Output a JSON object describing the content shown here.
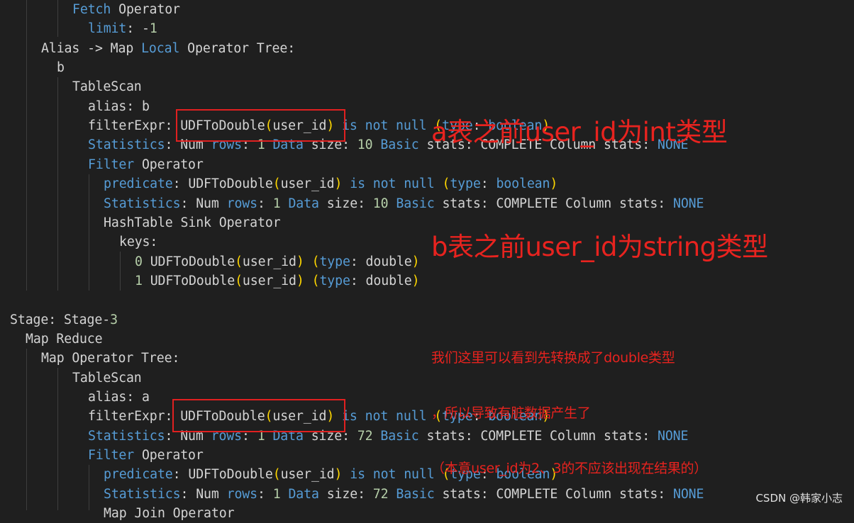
{
  "colors": {
    "background": "#1f1f1f",
    "plain": "#d4d4d4",
    "keyword": "#569cd6",
    "number": "#b5cea8",
    "paren": "#ffd700",
    "annotation": "#e8231f",
    "highlight_box": "#e02020"
  },
  "code_lines": [
    {
      "indent": 9,
      "tokens": [
        [
          "kw",
          "Fetch"
        ],
        [
          "plain",
          " Operator"
        ]
      ]
    },
    {
      "indent": 11,
      "tokens": [
        [
          "kw",
          "limit"
        ],
        [
          "plain",
          ": -"
        ],
        [
          "num",
          "1"
        ]
      ]
    },
    {
      "indent": 5,
      "tokens": [
        [
          "plain",
          "Alias -> Map "
        ],
        [
          "kw",
          "Local"
        ],
        [
          "plain",
          " Operator Tree:"
        ]
      ]
    },
    {
      "indent": 7,
      "tokens": [
        [
          "plain",
          "b"
        ]
      ]
    },
    {
      "indent": 9,
      "tokens": [
        [
          "plain",
          "TableScan"
        ]
      ]
    },
    {
      "indent": 11,
      "tokens": [
        [
          "plain",
          "alias: b"
        ]
      ]
    },
    {
      "indent": 11,
      "tokens": [
        [
          "plain",
          "filterExpr: UDFToDouble"
        ],
        [
          "paren",
          "("
        ],
        [
          "plain",
          "user_id"
        ],
        [
          "paren",
          ")"
        ],
        [
          "plain",
          " "
        ],
        [
          "kw",
          "is not null"
        ],
        [
          "plain",
          " "
        ],
        [
          "paren",
          "("
        ],
        [
          "kw",
          "type"
        ],
        [
          "plain",
          ": "
        ],
        [
          "kw",
          "boolean"
        ],
        [
          "paren",
          ")"
        ]
      ]
    },
    {
      "indent": 11,
      "tokens": [
        [
          "kw",
          "Statistics"
        ],
        [
          "plain",
          ": Num "
        ],
        [
          "kw",
          "rows"
        ],
        [
          "plain",
          ": "
        ],
        [
          "num",
          "1"
        ],
        [
          "plain",
          " "
        ],
        [
          "kw",
          "Data"
        ],
        [
          "plain",
          " size: "
        ],
        [
          "num",
          "10"
        ],
        [
          "plain",
          " "
        ],
        [
          "kw",
          "Basic"
        ],
        [
          "plain",
          " stats: COMPLETE Column stats: "
        ],
        [
          "kw",
          "NONE"
        ]
      ]
    },
    {
      "indent": 11,
      "tokens": [
        [
          "kw",
          "Filter"
        ],
        [
          "plain",
          " Operator"
        ]
      ]
    },
    {
      "indent": 13,
      "tokens": [
        [
          "kw",
          "predicate"
        ],
        [
          "plain",
          ": UDFToDouble"
        ],
        [
          "paren",
          "("
        ],
        [
          "plain",
          "user_id"
        ],
        [
          "paren",
          ")"
        ],
        [
          "plain",
          " "
        ],
        [
          "kw",
          "is not null"
        ],
        [
          "plain",
          " "
        ],
        [
          "paren",
          "("
        ],
        [
          "kw",
          "type"
        ],
        [
          "plain",
          ": "
        ],
        [
          "kw",
          "boolean"
        ],
        [
          "paren",
          ")"
        ]
      ]
    },
    {
      "indent": 13,
      "tokens": [
        [
          "kw",
          "Statistics"
        ],
        [
          "plain",
          ": Num "
        ],
        [
          "kw",
          "rows"
        ],
        [
          "plain",
          ": "
        ],
        [
          "num",
          "1"
        ],
        [
          "plain",
          " "
        ],
        [
          "kw",
          "Data"
        ],
        [
          "plain",
          " size: "
        ],
        [
          "num",
          "10"
        ],
        [
          "plain",
          " "
        ],
        [
          "kw",
          "Basic"
        ],
        [
          "plain",
          " stats: COMPLETE Column stats: "
        ],
        [
          "kw",
          "NONE"
        ]
      ]
    },
    {
      "indent": 13,
      "tokens": [
        [
          "plain",
          "HashTable Sink Operator"
        ]
      ]
    },
    {
      "indent": 15,
      "tokens": [
        [
          "plain",
          "keys:"
        ]
      ]
    },
    {
      "indent": 17,
      "tokens": [
        [
          "num",
          "0"
        ],
        [
          "plain",
          " UDFToDouble"
        ],
        [
          "paren",
          "("
        ],
        [
          "plain",
          "user_id"
        ],
        [
          "paren",
          ")"
        ],
        [
          "plain",
          " "
        ],
        [
          "paren",
          "("
        ],
        [
          "kw",
          "type"
        ],
        [
          "plain",
          ": double"
        ],
        [
          "paren",
          ")"
        ]
      ]
    },
    {
      "indent": 17,
      "tokens": [
        [
          "num",
          "1"
        ],
        [
          "plain",
          " UDFToDouble"
        ],
        [
          "paren",
          "("
        ],
        [
          "plain",
          "user_id"
        ],
        [
          "paren",
          ")"
        ],
        [
          "plain",
          " "
        ],
        [
          "paren",
          "("
        ],
        [
          "kw",
          "type"
        ],
        [
          "plain",
          ": double"
        ],
        [
          "paren",
          ")"
        ]
      ]
    },
    {
      "indent": 0,
      "tokens": []
    },
    {
      "indent": 1,
      "tokens": [
        [
          "plain",
          "Stage: Stage-"
        ],
        [
          "num",
          "3"
        ]
      ]
    },
    {
      "indent": 3,
      "tokens": [
        [
          "plain",
          "Map Reduce"
        ]
      ]
    },
    {
      "indent": 5,
      "tokens": [
        [
          "plain",
          "Map Operator Tree:"
        ]
      ]
    },
    {
      "indent": 9,
      "tokens": [
        [
          "plain",
          "TableScan"
        ]
      ]
    },
    {
      "indent": 11,
      "tokens": [
        [
          "plain",
          "alias: a"
        ]
      ]
    },
    {
      "indent": 11,
      "tokens": [
        [
          "plain",
          "filterExpr: UDFToDouble"
        ],
        [
          "paren",
          "("
        ],
        [
          "plain",
          "user_id"
        ],
        [
          "paren",
          ")"
        ],
        [
          "plain",
          " "
        ],
        [
          "kw",
          "is not null"
        ],
        [
          "plain",
          " "
        ],
        [
          "paren",
          "("
        ],
        [
          "kw",
          "type"
        ],
        [
          "plain",
          ": "
        ],
        [
          "kw",
          "boolean"
        ],
        [
          "paren",
          ")"
        ]
      ]
    },
    {
      "indent": 11,
      "tokens": [
        [
          "kw",
          "Statistics"
        ],
        [
          "plain",
          ": Num "
        ],
        [
          "kw",
          "rows"
        ],
        [
          "plain",
          ": "
        ],
        [
          "num",
          "1"
        ],
        [
          "plain",
          " "
        ],
        [
          "kw",
          "Data"
        ],
        [
          "plain",
          " size: "
        ],
        [
          "num",
          "72"
        ],
        [
          "plain",
          " "
        ],
        [
          "kw",
          "Basic"
        ],
        [
          "plain",
          " stats: COMPLETE Column stats: "
        ],
        [
          "kw",
          "NONE"
        ]
      ]
    },
    {
      "indent": 11,
      "tokens": [
        [
          "kw",
          "Filter"
        ],
        [
          "plain",
          " Operator"
        ]
      ]
    },
    {
      "indent": 13,
      "tokens": [
        [
          "kw",
          "predicate"
        ],
        [
          "plain",
          ": UDFToDouble"
        ],
        [
          "paren",
          "("
        ],
        [
          "plain",
          "user_id"
        ],
        [
          "paren",
          ")"
        ],
        [
          "plain",
          " "
        ],
        [
          "kw",
          "is not null"
        ],
        [
          "plain",
          " "
        ],
        [
          "paren",
          "("
        ],
        [
          "kw",
          "type"
        ],
        [
          "plain",
          ": "
        ],
        [
          "kw",
          "boolean"
        ],
        [
          "paren",
          ")"
        ]
      ]
    },
    {
      "indent": 13,
      "tokens": [
        [
          "kw",
          "Statistics"
        ],
        [
          "plain",
          ": Num "
        ],
        [
          "kw",
          "rows"
        ],
        [
          "plain",
          ": "
        ],
        [
          "num",
          "1"
        ],
        [
          "plain",
          " "
        ],
        [
          "kw",
          "Data"
        ],
        [
          "plain",
          " size: "
        ],
        [
          "num",
          "72"
        ],
        [
          "plain",
          " "
        ],
        [
          "kw",
          "Basic"
        ],
        [
          "plain",
          " stats: COMPLETE Column stats: "
        ],
        [
          "kw",
          "NONE"
        ]
      ]
    },
    {
      "indent": 13,
      "tokens": [
        [
          "plain",
          "Map Join Operator"
        ]
      ]
    }
  ],
  "annotations": {
    "top_note": [
      "a表之前user_id为int类型",
      "b表之前user_id为string类型"
    ],
    "middle_note": [
      "我们这里可以看到先转换成了double类型",
      "，所以导致有脏数据产生了",
      "（本意user_id为2、3的不应该出现在结果的）"
    ],
    "highlighted_expression": "UDFToDouble(user_id)"
  },
  "watermark": "CSDN @韩家小志"
}
